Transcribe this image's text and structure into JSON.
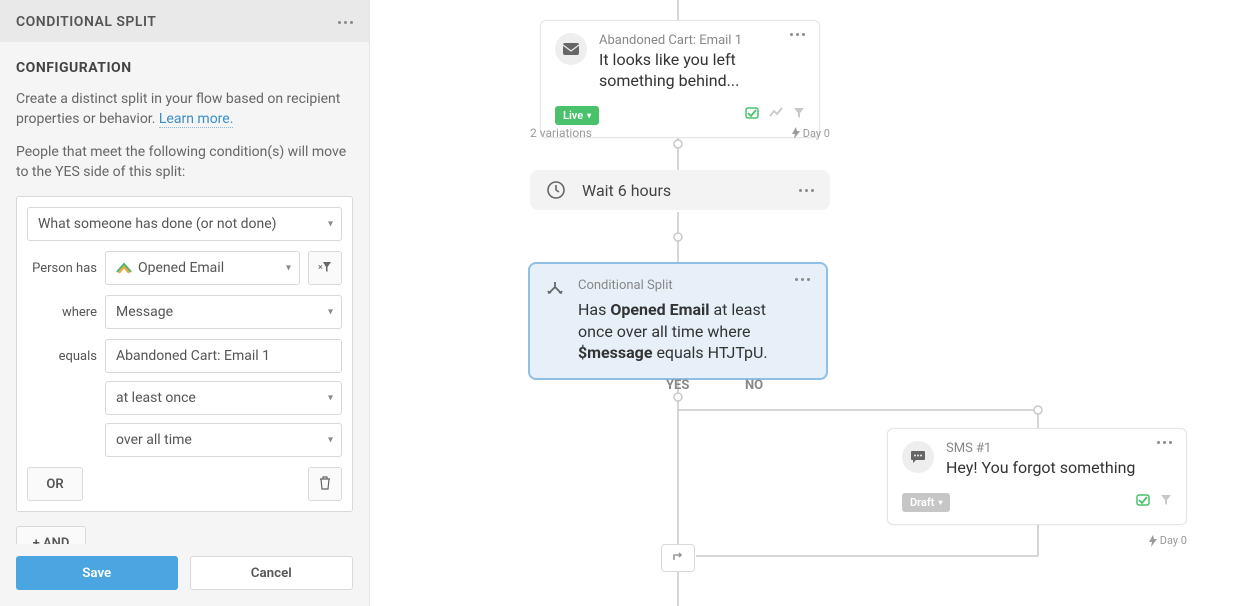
{
  "sidebar": {
    "header_title": "CONDITIONAL SPLIT",
    "config_title": "CONFIGURATION",
    "lead_text": "Create a distinct split in your flow based on recipient properties or behavior. ",
    "learn_more": "Learn more.",
    "condition_intro": "People that meet the following condition(s) will move to the YES side of this split:",
    "condition": {
      "type_label": "What someone has done (or not done)",
      "person_has_prefix": "Person has",
      "event_label": "Opened Email",
      "where_prefix": "where",
      "where_field": "Message",
      "equals_prefix": "equals",
      "equals_value": "Abandoned Cart: Email 1",
      "at_least": "at least once",
      "over_time": "over all time"
    },
    "or_label": "OR",
    "and_label": "+ AND",
    "save_label": "Save",
    "cancel_label": "Cancel"
  },
  "flow": {
    "email1": {
      "title": "Abandoned Cart: Email 1",
      "text": "It looks like you left something behind...",
      "status": "Live",
      "variations": "2 variations",
      "day": "Day 0"
    },
    "wait": {
      "label": "Wait 6 hours"
    },
    "conditional": {
      "title": "Conditional Split",
      "desc_parts": {
        "a": "Has ",
        "b": "Opened Email",
        "c": " at least once over all time where ",
        "d": "$message",
        "e": " equals HTJTpU."
      }
    },
    "branches": {
      "yes": "YES",
      "no": "NO"
    },
    "sms": {
      "title": "SMS #1",
      "text": "Hey! You forgot something",
      "status": "Draft",
      "day": "Day 0"
    }
  }
}
